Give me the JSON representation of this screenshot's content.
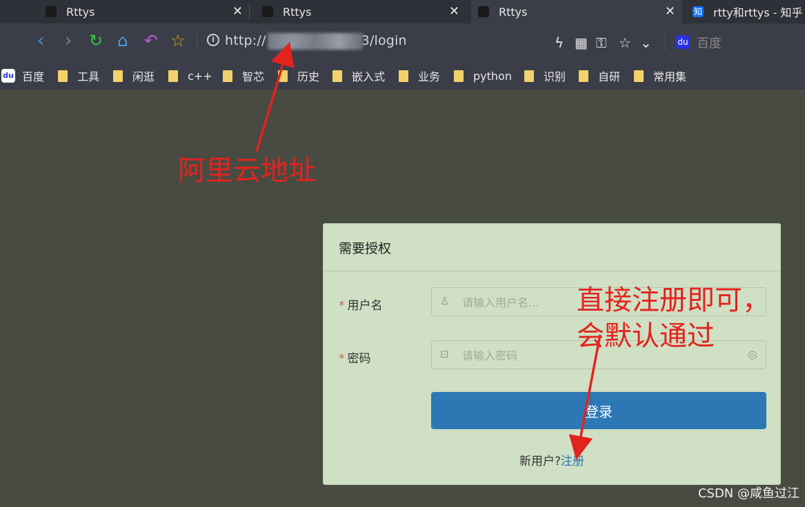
{
  "tabs": [
    {
      "title": "Rttys",
      "active": false
    },
    {
      "title": "Rttys",
      "active": false
    },
    {
      "title": "Rttys",
      "active": true
    },
    {
      "title": "rtty和rttys - 知乎",
      "active": false
    }
  ],
  "tab_close_glyph": "✕",
  "zhihu_glyph": "知",
  "address": {
    "url_prefix": "http://",
    "url_suffix": "3/login"
  },
  "search": {
    "placeholder": "百度",
    "engine_glyph": "du"
  },
  "bookmarks": [
    {
      "label": "百度",
      "type": "baidu"
    },
    {
      "label": "工具",
      "type": "folder"
    },
    {
      "label": "闲逛",
      "type": "folder"
    },
    {
      "label": "c++",
      "type": "folder"
    },
    {
      "label": "智芯",
      "type": "folder"
    },
    {
      "label": "历史",
      "type": "folder"
    },
    {
      "label": "嵌入式",
      "type": "folder"
    },
    {
      "label": "业务",
      "type": "folder"
    },
    {
      "label": "python",
      "type": "folder"
    },
    {
      "label": "识别",
      "type": "folder"
    },
    {
      "label": "自研",
      "type": "folder"
    },
    {
      "label": "常用集",
      "type": "folder"
    }
  ],
  "annotations": {
    "aliyun": "阿里云地址",
    "register_line1": "直接注册即可，",
    "register_line2": "会默认通过",
    "color": "#e3231e"
  },
  "login": {
    "title": "需要授权",
    "username_label": "用户名",
    "username_placeholder": "请输入用户名...",
    "password_label": "密码",
    "password_placeholder": "请输入密码",
    "required_mark": "*",
    "submit_label": "登录",
    "new_user_text": "新用户?",
    "register_link": "注册",
    "button_color": "#2d78b4"
  },
  "watermark": "CSDN @咸鱼过江"
}
